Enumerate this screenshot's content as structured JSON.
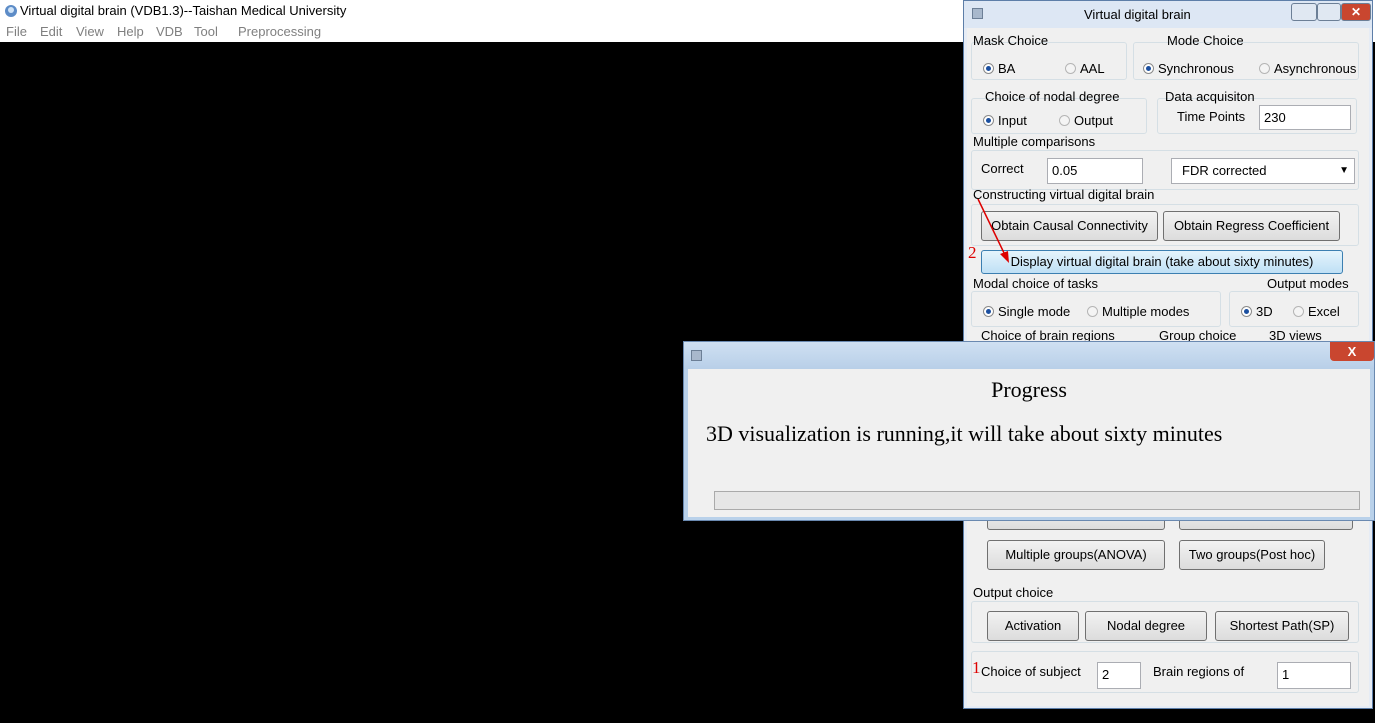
{
  "main_window": {
    "title": "Virtual digital brain (VDB1.3)--Taishan Medical University",
    "menu": [
      "File",
      "Edit",
      "View",
      "Help",
      "VDB",
      "Tool",
      "Preprocessing"
    ]
  },
  "panel": {
    "title": "Virtual  digital  brain",
    "mask_choice": {
      "label": "Mask Choice",
      "options": [
        "BA",
        "AAL"
      ],
      "selected": "BA"
    },
    "mode_choice": {
      "label": "Mode Choice",
      "options": [
        "Synchronous",
        "Asynchronous"
      ],
      "selected": "Synchronous"
    },
    "nodal_degree": {
      "label": "Choice of nodal degree",
      "options": [
        "Input",
        "Output"
      ],
      "selected": "Input"
    },
    "data_acquisition": {
      "label": "Data acquisiton",
      "time_points_label": "Time Points",
      "time_points_value": "230"
    },
    "multiple_comparisons": {
      "label": "Multiple comparisons",
      "correct_label": "Correct",
      "correct_value": "0.05",
      "method_selected": "FDR corrected"
    },
    "constructing": {
      "label": "Constructing virtual digital brain",
      "btn_causal": "Obtain  Causal Connectivity",
      "btn_regress": "Obtain Regress Coefficient"
    },
    "display_button": "Display virtual digital brain (take about sixty minutes)",
    "modal_tasks": {
      "label": "Modal choice of tasks",
      "options": [
        "Single mode",
        "Multiple modes"
      ],
      "selected": "Single mode"
    },
    "output_modes": {
      "label": "Output modes",
      "options": [
        "3D",
        "Excel"
      ],
      "selected": "3D"
    },
    "row_labels": {
      "brain_regions": "Choice of brain regions",
      "group_choice": "Group choice",
      "views_3d": "3D views"
    },
    "btn_anova": "Multiple groups(ANOVA)",
    "btn_posthoc": "Two groups(Post hoc)",
    "output_choice": {
      "label": "Output choice",
      "btn_activation": "Activation",
      "btn_nodal": "Nodal degree",
      "btn_sp": "Shortest Path(SP)"
    },
    "subject": {
      "label": "Choice of subject",
      "value": "2",
      "regions_label": "Brain regions of",
      "regions_value": "1"
    }
  },
  "annotations": {
    "marker_1": "1",
    "marker_2": "2",
    "color": "#dd0000"
  },
  "progress_dialog": {
    "heading": "Progress",
    "message": "3D visualization is running,it will take about sixty minutes",
    "close_label": "X",
    "progress_fraction": 0
  }
}
